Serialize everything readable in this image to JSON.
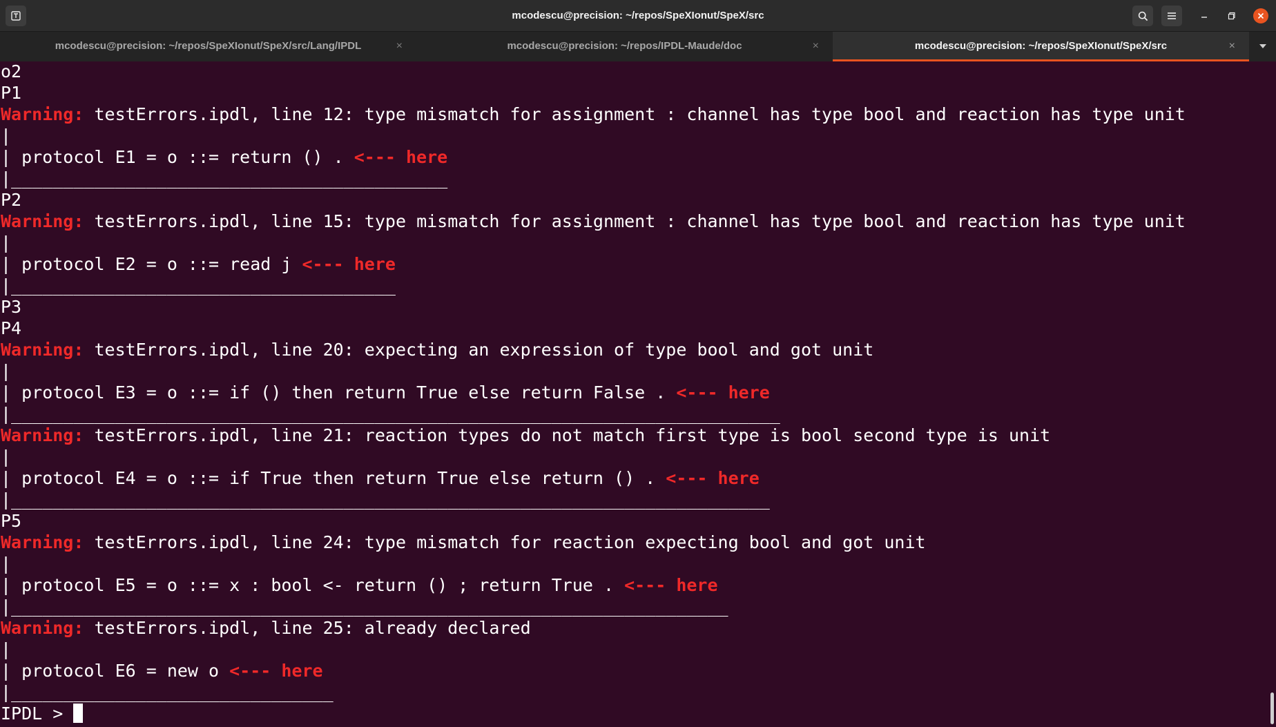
{
  "window": {
    "title": "mcodescu@precision: ~/repos/SpeXIonut/SpeX/src"
  },
  "colors": {
    "terminal_bg": "#300a24",
    "warning_text": "#ef2929",
    "tab_accent": "#e95420"
  },
  "icons": {
    "new_tab": "new-tab-icon",
    "search": "search-icon",
    "menu": "hamburger-menu-icon",
    "minimize": "minimize-icon",
    "maximize": "maximize-icon",
    "close": "close-icon",
    "tab_close": "×",
    "tabs_menu": "chevron-down-icon"
  },
  "tabs": [
    {
      "label": "mcodescu@precision: ~/repos/SpeXIonut/SpeX/src/Lang/IPDL",
      "close": "×",
      "active": false
    },
    {
      "label": "mcodescu@precision: ~/repos/IPDL-Maude/doc",
      "close": "×",
      "active": false
    },
    {
      "label": "mcodescu@precision: ~/repos/SpeXIonut/SpeX/src",
      "close": "×",
      "active": true
    }
  ],
  "terminal": {
    "lines": [
      {
        "text": "o2"
      },
      {
        "text": "P1"
      },
      {
        "prefix": "Warning:",
        "text": " testErrors.ipdl, line 12: type mismatch for assignment : channel has type bool and reaction has type unit"
      },
      {
        "text": "|"
      },
      {
        "text": "| protocol E1 = o ::= return () . ",
        "suffix": "<--- here"
      },
      {
        "text": "|__________________________________________"
      },
      {
        "text": "P2"
      },
      {
        "prefix": "Warning:",
        "text": " testErrors.ipdl, line 15: type mismatch for assignment : channel has type bool and reaction has type unit"
      },
      {
        "text": "|"
      },
      {
        "text": "| protocol E2 = o ::= read j ",
        "suffix": "<--- here"
      },
      {
        "text": "|_____________________________________"
      },
      {
        "text": "P3"
      },
      {
        "text": "P4"
      },
      {
        "prefix": "Warning:",
        "text": " testErrors.ipdl, line 20: expecting an expression of type bool and got unit"
      },
      {
        "text": "|"
      },
      {
        "text": "| protocol E3 = o ::= if () then return True else return False . ",
        "suffix": "<--- here"
      },
      {
        "text": "|__________________________________________________________________________"
      },
      {
        "prefix": "Warning:",
        "text": " testErrors.ipdl, line 21: reaction types do not match first type is bool second type is unit"
      },
      {
        "text": "|"
      },
      {
        "text": "| protocol E4 = o ::= if True then return True else return () . ",
        "suffix": "<--- here"
      },
      {
        "text": "|_________________________________________________________________________"
      },
      {
        "text": "P5"
      },
      {
        "prefix": "Warning:",
        "text": " testErrors.ipdl, line 24: type mismatch for reaction expecting bool and got unit"
      },
      {
        "text": "|"
      },
      {
        "text": "| protocol E5 = o ::= x : bool <- return () ; return True . ",
        "suffix": "<--- here"
      },
      {
        "text": "|_____________________________________________________________________"
      },
      {
        "prefix": "Warning:",
        "text": " testErrors.ipdl, line 25: already declared"
      },
      {
        "text": "|"
      },
      {
        "text": "| protocol E6 = new o ",
        "suffix": "<--- here"
      },
      {
        "text": "|_______________________________"
      }
    ],
    "prompt": "IPDL > "
  }
}
